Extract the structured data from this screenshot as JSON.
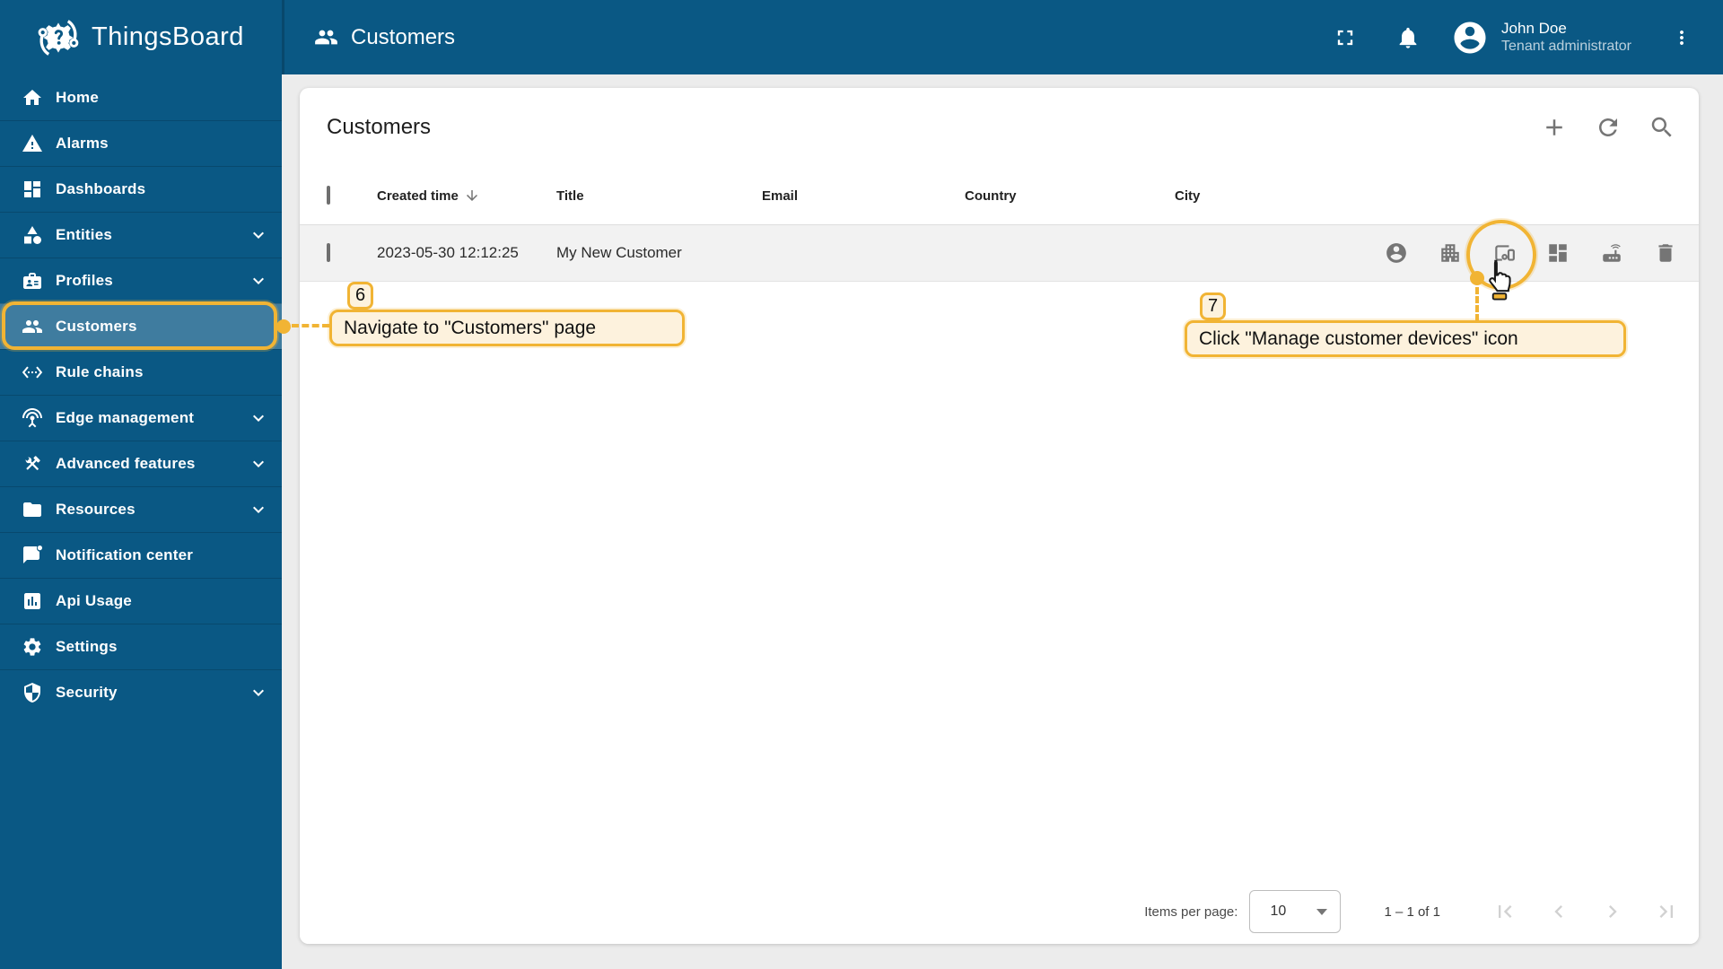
{
  "colors": {
    "primary": "#0a5884",
    "selected_item_bg": "rgba(255,255,255,0.22)",
    "content_bg": "#ececec",
    "row_bg": "#f2f2f2",
    "icon_gray": "#757575",
    "annotation_accent": "#f1b434",
    "annotation_bg": "#fdf2dd"
  },
  "app": {
    "logo_text": "ThingsBoard",
    "logo_icon": "thingsboard-gear-logo"
  },
  "topbar": {
    "title": "Customers",
    "title_icon": "people-icon",
    "icons": {
      "fullscreen": "fullscreen-icon",
      "notifications": "bell-icon",
      "menu": "kebab-menu-icon",
      "avatar": "account-circle-icon"
    },
    "user": {
      "name": "John Doe",
      "role": "Tenant administrator"
    }
  },
  "sidebar": {
    "items": [
      {
        "label": "Home",
        "icon": "home-icon",
        "selected": false,
        "expandable": false
      },
      {
        "label": "Alarms",
        "icon": "warning-triangle-icon",
        "selected": false,
        "expandable": false
      },
      {
        "label": "Dashboards",
        "icon": "dashboards-grid-icon",
        "selected": false,
        "expandable": false
      },
      {
        "label": "Entities",
        "icon": "entities-shapes-icon",
        "selected": false,
        "expandable": true
      },
      {
        "label": "Profiles",
        "icon": "profiles-badge-icon",
        "selected": false,
        "expandable": true
      },
      {
        "label": "Customers",
        "icon": "people-icon",
        "selected": true,
        "expandable": false
      },
      {
        "label": "Rule chains",
        "icon": "rule-chains-ethernet-icon",
        "selected": false,
        "expandable": false
      },
      {
        "label": "Edge management",
        "icon": "antenna-icon",
        "selected": false,
        "expandable": true
      },
      {
        "label": "Advanced features",
        "icon": "crossed-tools-icon",
        "selected": false,
        "expandable": true
      },
      {
        "label": "Resources",
        "icon": "folder-icon",
        "selected": false,
        "expandable": true
      },
      {
        "label": "Notification center",
        "icon": "notification-bubble-icon",
        "selected": false,
        "expandable": false
      },
      {
        "label": "Api Usage",
        "icon": "bar-chart-icon",
        "selected": false,
        "expandable": false
      },
      {
        "label": "Settings",
        "icon": "gear-icon",
        "selected": false,
        "expandable": false
      },
      {
        "label": "Security",
        "icon": "shield-icon",
        "selected": false,
        "expandable": true
      }
    ]
  },
  "main": {
    "card_title": "Customers",
    "toolbar": {
      "add_icon": "plus-icon",
      "refresh_icon": "refresh-icon",
      "search_icon": "search-icon"
    },
    "table": {
      "columns": [
        "Created time",
        "Title",
        "Email",
        "Country",
        "City"
      ],
      "sort": {
        "column": "Created time",
        "direction": "desc",
        "icon": "arrow-down-icon"
      },
      "rows": [
        {
          "created_time": "2023-05-30 12:12:25",
          "title": "My New Customer",
          "email": "",
          "country": "",
          "city": "",
          "actions": [
            "manage-customer-users",
            "manage-customer-assets",
            "manage-customer-devices",
            "manage-customer-dashboards",
            "manage-customer-edge-instances",
            "delete-customer"
          ]
        }
      ]
    },
    "paginator": {
      "items_per_page_label": "Items per page:",
      "page_size": "10",
      "range_label": "1 – 1 of 1",
      "nav_icons": [
        "first-page-icon",
        "prev-page-icon",
        "next-page-icon",
        "last-page-icon"
      ]
    }
  },
  "annotations": {
    "step6": {
      "number": "6",
      "text": "Navigate to \"Customers\" page",
      "target": "sidebar-item-customers"
    },
    "step7": {
      "number": "7",
      "text": "Click \"Manage customer devices\" icon",
      "target": "manage-customer-devices-action"
    }
  }
}
